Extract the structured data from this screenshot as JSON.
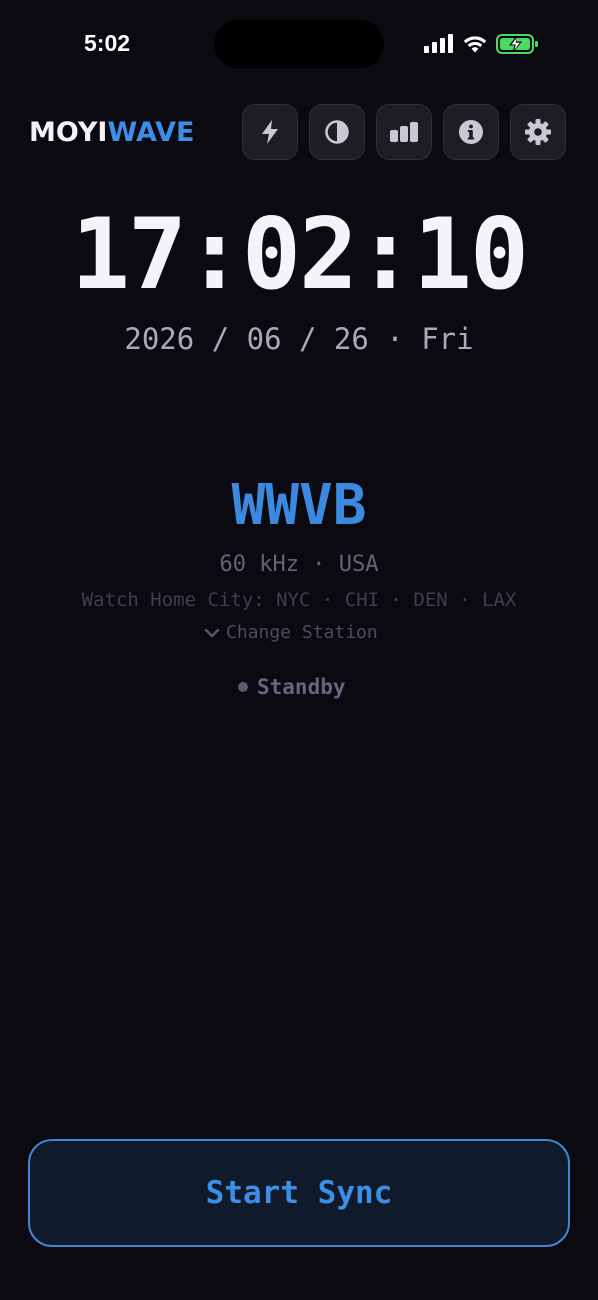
{
  "status_bar": {
    "time": "5:02",
    "battery_color": "#4cd964"
  },
  "header": {
    "logo_part1": "MOYI",
    "logo_part2": "WAVE",
    "toolbar": [
      {
        "icon": "bolt-icon"
      },
      {
        "icon": "contrast-icon"
      },
      {
        "icon": "bar-chart-icon"
      },
      {
        "icon": "info-icon"
      },
      {
        "icon": "gear-icon"
      }
    ]
  },
  "clock": {
    "time": "17:02:10",
    "date": "2026 / 06 / 26 · Fri"
  },
  "station": {
    "name": "WWVB",
    "frequency": "60 kHz · USA",
    "cities": "Watch Home City: NYC · CHI · DEN · LAX",
    "change_label": "Change Station",
    "status": "Standby"
  },
  "actions": {
    "start_label": "Start Sync"
  },
  "colors": {
    "accent": "#3d8ee6",
    "background": "#0a0a10"
  }
}
